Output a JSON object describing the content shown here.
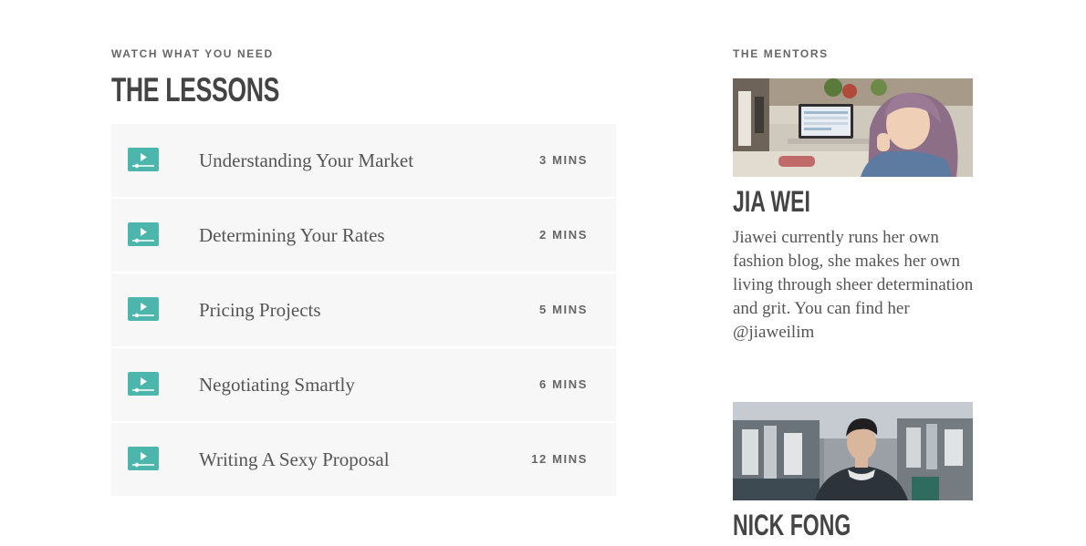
{
  "lessons_section": {
    "eyebrow": "WATCH WHAT YOU NEED",
    "title": "THE LESSONS",
    "items": [
      {
        "title": "Understanding Your Market",
        "duration": "3 MINS",
        "icon": "video-play-icon"
      },
      {
        "title": "Determining Your Rates",
        "duration": "2 MINS",
        "icon": "video-play-icon"
      },
      {
        "title": "Pricing Projects",
        "duration": "5 MINS",
        "icon": "video-play-icon"
      },
      {
        "title": "Negotiating Smartly",
        "duration": "6 MINS",
        "icon": "video-play-icon"
      },
      {
        "title": "Writing A Sexy Proposal",
        "duration": "12 MINS",
        "icon": "video-play-icon"
      }
    ]
  },
  "mentors_section": {
    "eyebrow": "THE MENTORS",
    "mentors": [
      {
        "name": "JIA WEI",
        "bio": "Jiawei currently runs her own fashion blog, she makes her own living through sheer determination and grit. You can find her @jiaweilim"
      },
      {
        "name": "NICK FONG"
      }
    ]
  },
  "colors": {
    "accent": "#4db6ac",
    "row_background": "#f7f7f7",
    "heading": "#444444",
    "text": "#555555"
  }
}
